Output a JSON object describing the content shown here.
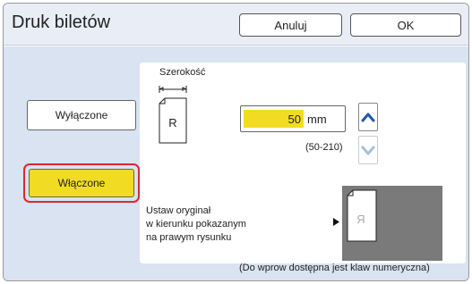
{
  "header": {
    "title": "Druk biletów",
    "cancel_label": "Anuluj",
    "ok_label": "OK"
  },
  "options": {
    "off_label": "Wyłączone",
    "on_label": "Włączone",
    "selected": "Włączone"
  },
  "panel": {
    "width_label": "Szerokość",
    "diagram_letter": "R",
    "input_value": "50",
    "unit": "mm",
    "range": "(50-210)",
    "instruction_lines": [
      "Ustaw oryginał",
      "w kierunku pokazanym",
      "na prawym rysunku"
    ],
    "original_letter": "Я"
  },
  "footer": {
    "note": "(Do wprow dostępna jest klaw numeryczna)"
  },
  "icons": {
    "step_up": "chevron-up-icon",
    "step_down": "chevron-down-icon",
    "pointer": "triangle-right-icon"
  },
  "colors": {
    "accent": "#f2dc23",
    "selection_ring": "#e0262d",
    "header_bg": "#e9eef6",
    "body_bg": "#d9e3f1",
    "stepper_blue": "#1f5aa6",
    "stepper_disabled": "#a8bfde"
  }
}
